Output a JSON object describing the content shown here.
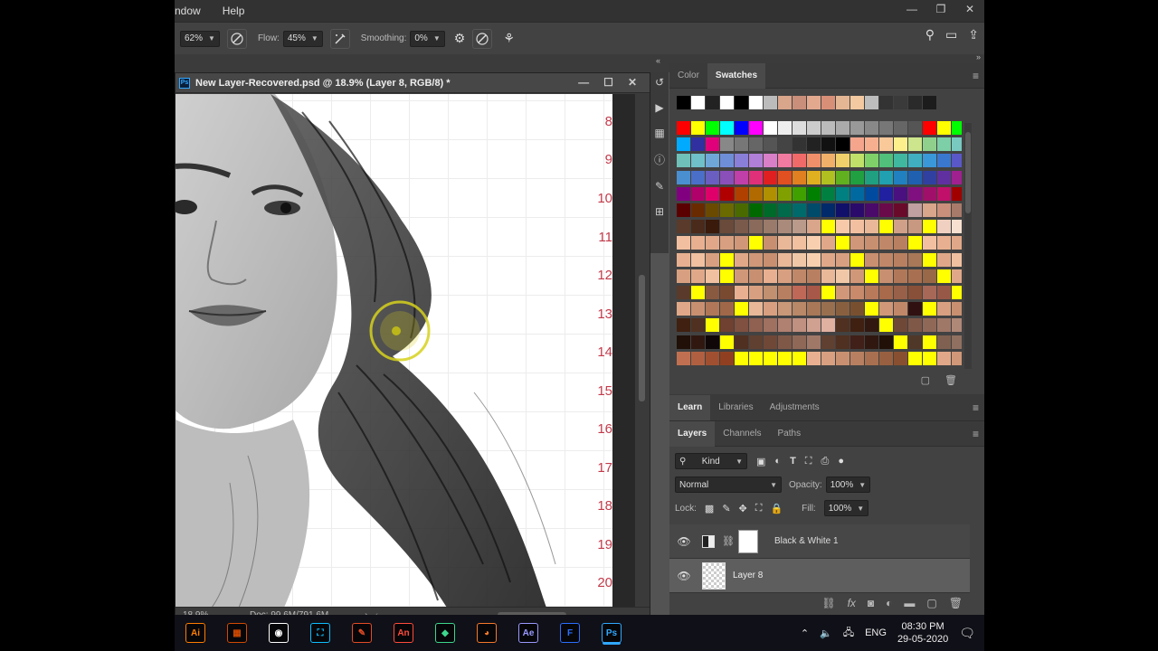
{
  "menu": {
    "items": [
      "ndow",
      "Help"
    ]
  },
  "window_controls": [
    "—",
    "❐",
    "✕"
  ],
  "options_bar": {
    "size_value": "62%",
    "flow_label": "Flow:",
    "flow_value": "45%",
    "smoothing_label": "Smoothing:",
    "smoothing_value": "0%"
  },
  "document": {
    "title": "New Layer-Recovered.psd @ 18.9% (Layer 8, RGB/8) *",
    "badge": "Ps",
    "zoom": "18.9%",
    "doc_size": "Doc: 99.6M/791.6M",
    "row_numbers": [
      "8",
      "9",
      "10",
      "11",
      "12",
      "13",
      "14",
      "15",
      "16",
      "17",
      "18",
      "19",
      "20"
    ]
  },
  "color_panel": {
    "tabs": [
      "Color",
      "Swatches"
    ],
    "active_tab": "Swatches"
  },
  "learn_panel": {
    "tabs": [
      "Learn",
      "Libraries",
      "Adjustments"
    ]
  },
  "layers_panel": {
    "tabs": [
      "Layers",
      "Channels",
      "Paths"
    ],
    "filter_kind": "Kind",
    "blend_mode": "Normal",
    "opacity_label": "Opacity:",
    "opacity_value": "100%",
    "lock_label": "Lock:",
    "fill_label": "Fill:",
    "fill_value": "100%",
    "layers": [
      {
        "name": "Black & White 1",
        "visible": true,
        "selected": false
      },
      {
        "name": "Layer 8",
        "visible": true,
        "selected": true
      }
    ]
  },
  "taskbar": {
    "apps": [
      {
        "label": "Ai",
        "color": "#ff7c00"
      },
      {
        "label": "▦",
        "color": "#d04a02"
      },
      {
        "label": "◉",
        "color": "#ffffff"
      },
      {
        "label": "⛶",
        "color": "#0ebeff"
      },
      {
        "label": "✎",
        "color": "#e34c26"
      },
      {
        "label": "An",
        "color": "#ff4c3b"
      },
      {
        "label": "◆",
        "color": "#3dd68c"
      },
      {
        "label": "◕",
        "color": "#f5792a"
      },
      {
        "label": "Ae",
        "color": "#9999ff"
      },
      {
        "label": "F",
        "color": "#2b6fff"
      },
      {
        "label": "Ps",
        "color": "#31a8ff"
      }
    ],
    "language": "ENG",
    "time": "08:30 PM",
    "date": "29-05-2020"
  },
  "colors": {
    "accent_ps": "#31a8ff",
    "row_number": "#c23a4a",
    "panel_bg": "#424242"
  }
}
